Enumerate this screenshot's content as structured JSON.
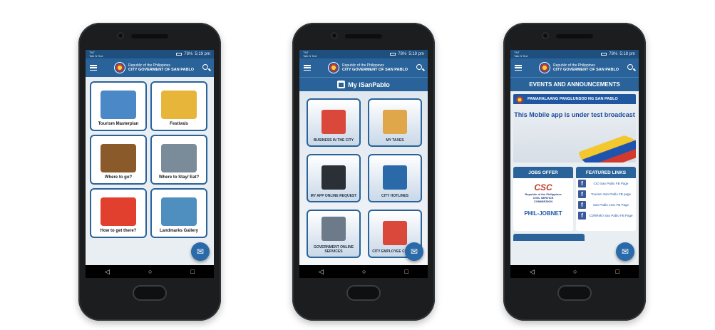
{
  "status": {
    "carrier_lines": [
      "TNT",
      "Talk N Text"
    ],
    "battery": "78%",
    "times": [
      "5:19 pm",
      "5:19 pm",
      "5:18 pm"
    ]
  },
  "header": {
    "line1": "Republic of the Philippines",
    "line2": "CITY GOVERMENT OF SAN PABLO"
  },
  "phone1": {
    "tiles": [
      {
        "label": "Tourism Masterplan",
        "icon": "map-icon",
        "color": "#4a88c7"
      },
      {
        "label": "Festivals",
        "icon": "festival-icon",
        "color": "#e7b53a"
      },
      {
        "label": "Where to go?",
        "icon": "coconut-icon",
        "color": "#8a5a2b"
      },
      {
        "label": "Where to Stay/ Eat?",
        "icon": "house-icon",
        "color": "#7a8b99"
      },
      {
        "label": "How to get there?",
        "icon": "map-pin-icon",
        "color": "#e2402f"
      },
      {
        "label": "Landmarks Gallery",
        "icon": "gallery-icon",
        "color": "#4f8fbf"
      }
    ]
  },
  "phone2": {
    "title": "My iSanPablo",
    "tiles": [
      {
        "label": "BUSINESS IN THE CITY",
        "icon": "building-icon",
        "color": "#d9483b"
      },
      {
        "label": "MY TAXES",
        "icon": "tax-chart-icon",
        "color": "#e0a64a"
      },
      {
        "label": "MY APP ONLINE REQUEST",
        "icon": "phone-request-icon",
        "color": "#2b2f36"
      },
      {
        "label": "CITY HOTLINES",
        "icon": "telephone-icon",
        "color": "#2a6aa8"
      },
      {
        "label": "GOVERNMENT ONLINE SERVICES",
        "icon": "government-building-icon",
        "color": "#6c7a89"
      },
      {
        "label": "CITY EMPLOYEE CORNER",
        "icon": "employee-icon",
        "color": "#d9483b"
      }
    ]
  },
  "phone3": {
    "events_title": "EVENTS AND ANNOUNCEMENTS",
    "event_strip": "PAMAHALAANG PANGLUNSOD NG SAN PABLO",
    "event_message": "This Mobile app is under test broadcast",
    "jobs_title": "JOBS OFFER",
    "csc_logo": "CSC",
    "csc_sub": [
      "Republic of the Philippines",
      "CIVIL SERVICE",
      "COMMISSION"
    ],
    "philjobnet": "PHIL-JOBNET",
    "featured_title": "FEATURED LINKS",
    "links": [
      "CIO San Pablo FB Page",
      "Tourism San Pablo FB page",
      "San Pablo LGU FB Page",
      "CDRRMO San Pablo FB Page"
    ]
  },
  "nav": {
    "back": "◁",
    "home": "○",
    "recent": "□"
  },
  "fab_icon": "✉"
}
